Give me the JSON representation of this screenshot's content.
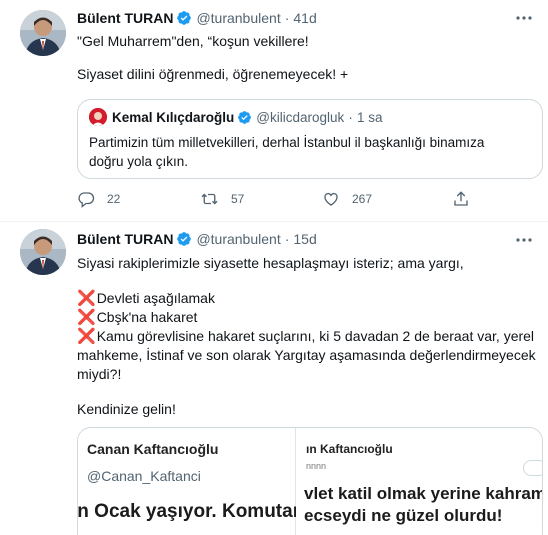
{
  "tweet1": {
    "name": "Bülent TURAN",
    "handle": "@turanbulent",
    "separator": "·",
    "time": "41d",
    "lines": [
      "\"Gel Muharrem\"den, “koşun vekillere!",
      "Siyaset dilini öğrenmedi, öğrenemeyecek! +"
    ],
    "quote": {
      "name": "Kemal Kılıçdaroğlu",
      "handle": "@kilicdarogluk",
      "separator": "·",
      "time": "1 sa",
      "lines": [
        "Partimizin tüm milletvekilleri, derhal İstanbul il başkanlığı binamıza",
        "doğru yola çıkın."
      ]
    },
    "actions": {
      "reply_count": "22",
      "retweet_count": "57",
      "like_count": "267"
    }
  },
  "tweet2": {
    "name": "Bülent TURAN",
    "handle": "@turanbulent",
    "separator": "·",
    "time": "15d",
    "intro": "Siyasi rakiplerimizle siyasette hesaplaşmayı isteriz; ama yargı,",
    "cross_mark": "❌",
    "items": [
      "Devleti aşağılamak",
      "Cbşk'na hakaret",
      "Kamu görevlisine hakaret suçlarını, ki 5 davadan 2 de beraat var, yerel"
    ],
    "item_cont": [
      "mahkeme, İstinaf ve son olarak Yargıtay aşamasında değerlendirmeyecek",
      "miydi?!"
    ],
    "closing": "Kendinize gelin!",
    "media": {
      "left_name": "Canan Kaftancıoğlu",
      "left_handle": "@Canan_Kaftanci",
      "left_text": "ın Ocak yaşıyor. Komutan",
      "right_name": "ın Kaftancıoğlu",
      "right_handle": "nnnn",
      "right_text_1": "vlet katil olmak yerine kahram",
      "right_text_2": "ecseydi ne güzel olurdu!"
    }
  },
  "colors": {
    "accent": "#1d9bf0",
    "muted": "#536471",
    "cross": "#de2a42",
    "border": "#cfd9de"
  },
  "icons": {
    "more": "more-horizontal-icon",
    "verified": "verified-badge-icon",
    "reply": "reply-icon",
    "retweet": "retweet-icon",
    "like": "heart-icon",
    "share": "share-icon"
  }
}
